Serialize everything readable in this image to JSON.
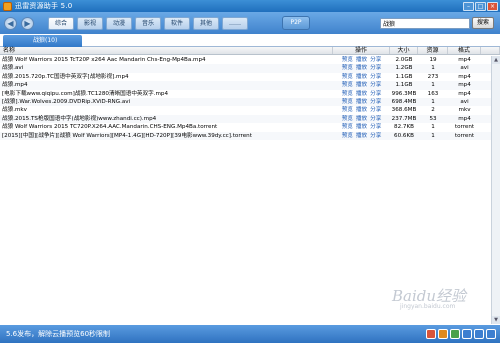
{
  "window": {
    "title": "迅雷资源助手 5.0",
    "minimize": "–",
    "maximize": "□",
    "close": "×"
  },
  "toolbar": {
    "back": "◀",
    "forward": "▶",
    "categories": [
      "综合",
      "影视",
      "动漫",
      "音乐",
      "软件",
      "其他",
      "……"
    ],
    "p2p_label": "P2P",
    "search_value": "战狼",
    "search_button": "搜索"
  },
  "tab": {
    "label": "战狼(10)"
  },
  "table": {
    "headers": {
      "name": "名称",
      "ops": "操作",
      "size": "大小",
      "resources": "资源",
      "format": "格式"
    },
    "op_labels": [
      "预览",
      "播放",
      "分享"
    ],
    "rows": [
      {
        "name": "战狼 Wolf Warriors 2015 TcT20P x264 Aac Mandarin Chs-Eng-Mp4Ba.mp4",
        "size": "2.0GB",
        "res": "19",
        "fmt": "mp4"
      },
      {
        "name": "战狼.avi",
        "size": "1.2GB",
        "res": "1",
        "fmt": "avi"
      },
      {
        "name": "战狼.2015.720p.TC国语中英双字[战地影视].mp4",
        "size": "1.1GB",
        "res": "273",
        "fmt": "mp4"
      },
      {
        "name": "战狼.mp4",
        "size": "1.1GB",
        "res": "1",
        "fmt": "mp4"
      },
      {
        "name": "[电影下载www.qiqipu.com]战狼.TC1280清晰国语中英双字.mp4",
        "size": "996.3MB",
        "res": "163",
        "fmt": "mp4"
      },
      {
        "name": "[战狼].War.Wolves.2009.DVDRip.XViD-RNG.avi",
        "size": "698.4MB",
        "res": "1",
        "fmt": "avi"
      },
      {
        "name": "战狼.mkv",
        "size": "368.6MB",
        "res": "2",
        "fmt": "mkv"
      },
      {
        "name": "战狼.2015.TS枪版国语中字(战地影视)www.zhandi.cc).mp4",
        "size": "237.7MB",
        "res": "53",
        "fmt": "mp4"
      },
      {
        "name": "战狼 Wolf Warriors 2015 TC720P.X264.AAC.Mandarin.CHS-ENG.Mp4Ba.torrent",
        "size": "82.7KB",
        "res": "1",
        "fmt": "torrent"
      },
      {
        "name": "[2015][中国][战争片][战狼 Wolf Warriors][MP4-1.4G][HD-720P][39电影www.39dy.cc].torrent",
        "size": "60.6KB",
        "res": "1",
        "fmt": "torrent"
      }
    ]
  },
  "statusbar": {
    "text": "5.6发布，解除云播预览60秒限制",
    "icons": [
      "app-icon",
      "skin-icon",
      "settings-icon",
      "help-icon",
      "feedback-icon",
      "info-icon"
    ]
  },
  "watermark": {
    "text": "Baidu经验",
    "sub": "jingyan.baidu.com"
  },
  "colors": {
    "titlebar": "#1f6fbd",
    "toolbar": "#3f82cc",
    "status": "#2f72c0",
    "link": "#1a59b5"
  }
}
